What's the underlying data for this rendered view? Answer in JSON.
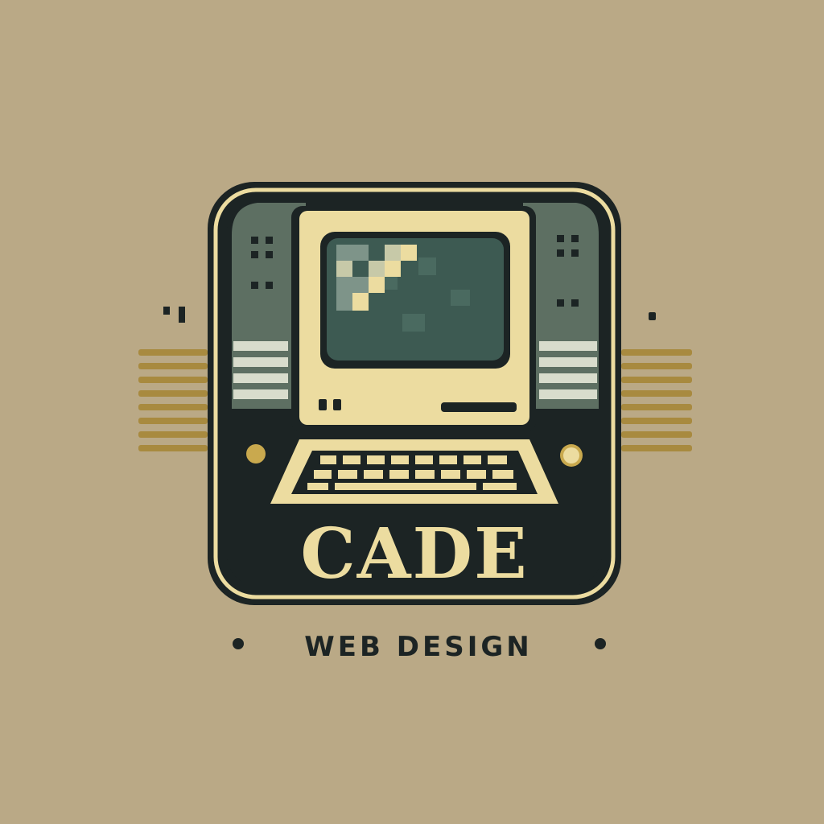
{
  "logo": {
    "wordmark": "CADE",
    "tagline": "WEB DESIGN"
  },
  "colors": {
    "background": "#baa986",
    "dark": "#1c2424",
    "cream": "#ecdca0",
    "gold": "#c9a94e",
    "screen_green": "#3d5a52",
    "panel_green": "#5d6f62",
    "stripe_light": "#d8dccc"
  },
  "icons": [
    "retro-computer-icon",
    "keyboard-icon",
    "monitor-icon"
  ]
}
